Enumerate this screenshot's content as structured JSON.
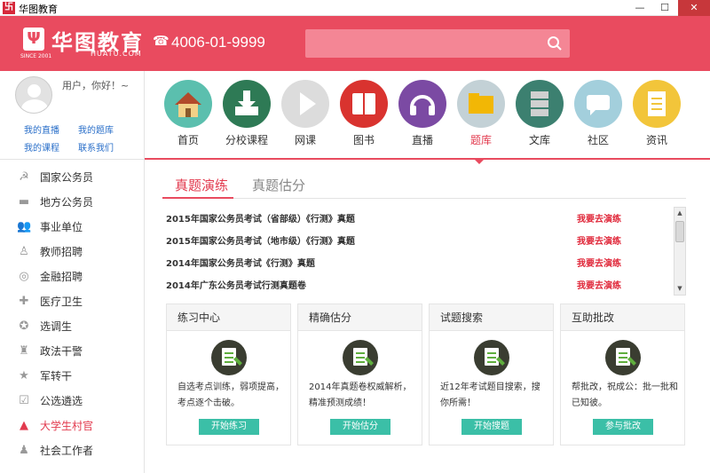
{
  "window": {
    "title": "华图教育",
    "app_icon_glyph": "卐",
    "min": "—",
    "max": "☐",
    "close": "✕"
  },
  "header": {
    "logo_mark": "Ψ",
    "logo_text": "华图教育",
    "logo_sub": "HUATU.COM",
    "logo_since": "SINCE 2001",
    "phone_icon": "☎",
    "phone": "4006-01-9999",
    "search_placeholder": ""
  },
  "sidebar": {
    "greeting": "用户，你好！~",
    "links": [
      "我的直播",
      "我的题库",
      "我的课程",
      "联系我们"
    ],
    "items": [
      {
        "label": "国家公务员",
        "icon": "emblem-icon",
        "glyph": "☭"
      },
      {
        "label": "地方公务员",
        "icon": "hat-icon",
        "glyph": "▬"
      },
      {
        "label": "事业单位",
        "icon": "people-icon",
        "glyph": "👥"
      },
      {
        "label": "教师招聘",
        "icon": "teacher-icon",
        "glyph": "♙"
      },
      {
        "label": "金融招聘",
        "icon": "coin-icon",
        "glyph": "◎"
      },
      {
        "label": "医疗卫生",
        "icon": "cross-icon",
        "glyph": "✚"
      },
      {
        "label": "选调生",
        "icon": "seal-icon",
        "glyph": "✪"
      },
      {
        "label": "政法干警",
        "icon": "police-icon",
        "glyph": "♜"
      },
      {
        "label": "军转干",
        "icon": "star-icon",
        "glyph": "★"
      },
      {
        "label": "公选遴选",
        "icon": "vote-icon",
        "glyph": "☑"
      },
      {
        "label": "大学生村官",
        "icon": "mountain-icon",
        "glyph": "▲"
      },
      {
        "label": "社会工作者",
        "icon": "worker-icon",
        "glyph": "♟"
      }
    ],
    "active_color": "#e23a4e"
  },
  "top_nav": {
    "items": [
      {
        "label": "首页",
        "icon": "home-icon",
        "color": "#5bbfae"
      },
      {
        "label": "分校课程",
        "icon": "download-icon",
        "color": "#2e7a55"
      },
      {
        "label": "网课",
        "icon": "play-icon",
        "color": "#dcdcdc"
      },
      {
        "label": "图书",
        "icon": "book-icon",
        "color": "#d9332f"
      },
      {
        "label": "直播",
        "icon": "headphones-icon",
        "color": "#7b4aa3"
      },
      {
        "label": "题库",
        "icon": "folder-icon",
        "color": "#c3d1d6"
      },
      {
        "label": "文库",
        "icon": "database-icon",
        "color": "#3c8070"
      },
      {
        "label": "社区",
        "icon": "chat-icon",
        "color": "#a3cfdc"
      },
      {
        "label": "资讯",
        "icon": "document-icon",
        "color": "#f2c53a"
      }
    ],
    "active_index": 5
  },
  "tabs": {
    "active": "真题演练",
    "inactive": "真题估分"
  },
  "exam_list": [
    {
      "title": "2015年国家公务员考试（省部级）《行测》真题",
      "action": "我要去演练"
    },
    {
      "title": "2015年国家公务员考试（地市级）《行测》真题",
      "action": "我要去演练"
    },
    {
      "title": "2014年国家公务员考试《行测》真题",
      "action": "我要去演练"
    },
    {
      "title": "2014年广东公务员考试行测真题卷",
      "action": "我要去演练"
    }
  ],
  "scrollbar": {
    "up": "▲",
    "down": "▼"
  },
  "cards": [
    {
      "title": "练习中心",
      "desc": "自选考点训练，弱项提高，考点逐个击破。",
      "button": "开始练习"
    },
    {
      "title": "精确估分",
      "desc": "2014年真题卷权威解析，精准预测成绩！",
      "button": "开始估分"
    },
    {
      "title": "试题搜索",
      "desc": "近12年考试题目搜索，搜你所需！",
      "button": "开始搜题"
    },
    {
      "title": "互助批改",
      "desc": "帮批改，祝成公：批一批和已知彼。",
      "button": "参与批改"
    }
  ]
}
